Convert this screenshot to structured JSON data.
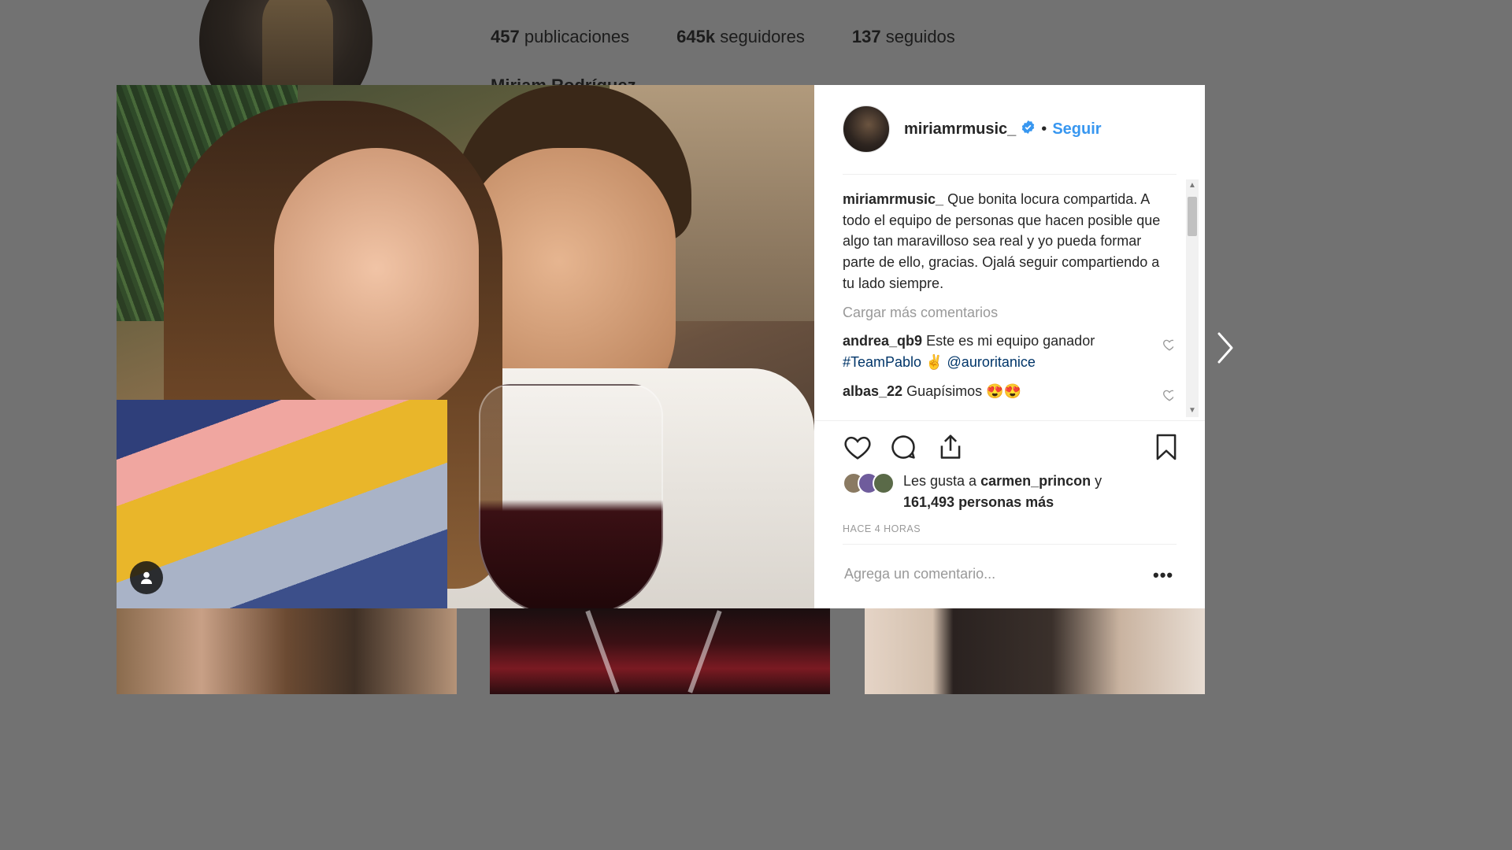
{
  "profile": {
    "stats": [
      {
        "count": "457",
        "label": "publicaciones"
      },
      {
        "count": "645k",
        "label": "seguidores"
      },
      {
        "count": "137",
        "label": "seguidos"
      }
    ],
    "name": "Miriam Rodríguez"
  },
  "post": {
    "username": "miriamrmusic_",
    "follow_label": "Seguir",
    "caption_user": "miriamrmusic_",
    "caption_text": "Que bonita locura compartida. A todo el equipo de personas que hacen posible que algo tan maravilloso sea real y yo pueda formar parte de ello, gracias. Ojalá seguir compartiendo a tu lado siempre.",
    "load_more": "Cargar más comentarios",
    "comments": [
      {
        "user": "andrea_qb9",
        "text_before": "Este es mi equipo ganador",
        "hashtag": "#TeamPablo",
        "emoji": "✌",
        "mention": "@auroritanice"
      },
      {
        "user": "albas_22",
        "text": "Guapísimos 😍😍"
      }
    ],
    "likes_prefix": "Les gusta a",
    "likes_user": "carmen_princon",
    "likes_conj": "y",
    "likes_count": "161,493 personas más",
    "time": "HACE 4 HORAS",
    "add_comment_placeholder": "Agrega un comentario...",
    "more_label": "•••"
  },
  "icons": {
    "verified": "verified-badge-icon",
    "like": "heart-icon",
    "comment": "comment-bubble-icon",
    "share": "share-icon",
    "save": "bookmark-icon",
    "user_tag": "user-tag-icon",
    "next": "chevron-right-icon"
  },
  "colors": {
    "accent": "#3897f0",
    "text": "#262626",
    "muted": "#999999",
    "link": "#003569"
  }
}
